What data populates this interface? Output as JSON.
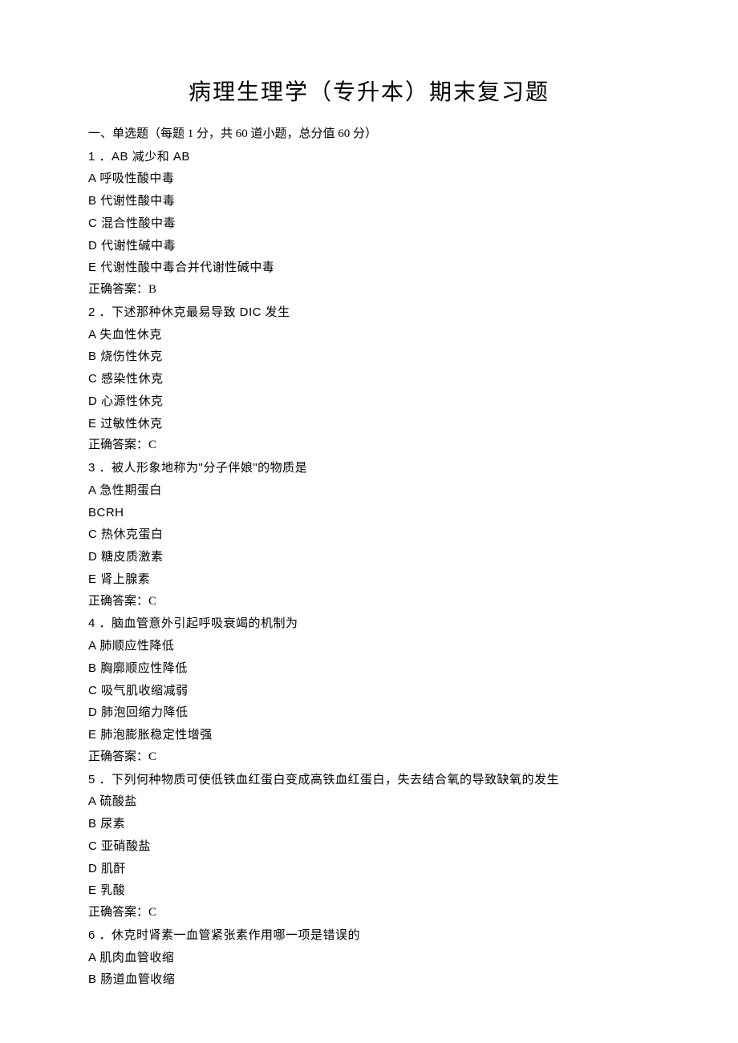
{
  "title": "病理生理学（专升本）期末复习题",
  "section_header": "一、单选题（每题 1 分，共 60 道小题，总分值 60 分）",
  "answer_prefix": "正确答案：",
  "questions": [
    {
      "num": "1",
      "stem": "．AB 减少和 AB",
      "options": [
        {
          "label": "A",
          "text": "呼吸性酸中毒"
        },
        {
          "label": "B",
          "text": "代谢性酸中毒"
        },
        {
          "label": "C",
          "text": "混合性酸中毒"
        },
        {
          "label": "D",
          "text": "代谢性碱中毒"
        },
        {
          "label": "E",
          "text": "代谢性酸中毒合并代谢性碱中毒"
        }
      ],
      "answer": "B"
    },
    {
      "num": "2",
      "stem": "．下述那种休克最易导致 DIC 发生",
      "options": [
        {
          "label": "A",
          "text": "失血性休克"
        },
        {
          "label": "B",
          "text": "烧伤性休克"
        },
        {
          "label": "C",
          "text": "感染性休克"
        },
        {
          "label": "D",
          "text": "心源性休克"
        },
        {
          "label": "E",
          "text": "过敏性休克"
        }
      ],
      "answer": "C"
    },
    {
      "num": "3",
      "stem": "．被人形象地称为\"分子伴娘\"的物质是",
      "options": [
        {
          "label": "A",
          "text": "急性期蛋白"
        },
        {
          "label": "BCRH",
          "text": ""
        },
        {
          "label": "C",
          "text": "热休克蛋白"
        },
        {
          "label": "D",
          "text": "糖皮质激素"
        },
        {
          "label": "E",
          "text": "肾上腺素"
        }
      ],
      "answer": "C"
    },
    {
      "num": "4",
      "stem": "．脑血管意外引起呼吸衰竭的机制为",
      "options": [
        {
          "label": "A",
          "text": "肺顺应性降低"
        },
        {
          "label": "B",
          "text": "胸廓顺应性降低"
        },
        {
          "label": "C",
          "text": "吸气肌收缩减弱"
        },
        {
          "label": "D",
          "text": "肺泡回缩力降低"
        },
        {
          "label": "E",
          "text": "肺泡膨胀稳定性增强"
        }
      ],
      "answer": "C"
    },
    {
      "num": "5",
      "stem": "．下列何种物质可使低铁血红蛋白变成高铁血红蛋白，失去结合氧的导致缺氧的发生",
      "options": [
        {
          "label": "A",
          "text": "硫酸盐"
        },
        {
          "label": "B",
          "text": "尿素"
        },
        {
          "label": "C",
          "text": "亚硝酸盐"
        },
        {
          "label": "D",
          "text": "肌酐"
        },
        {
          "label": "E",
          "text": "乳酸"
        }
      ],
      "answer": "C"
    },
    {
      "num": "6",
      "stem": "．休克时肾素一血管紧张素作用哪一项是错误的",
      "options": [
        {
          "label": "A",
          "text": "肌肉血管收缩"
        },
        {
          "label": "B",
          "text": "肠道血管收缩"
        }
      ],
      "answer": null
    }
  ]
}
